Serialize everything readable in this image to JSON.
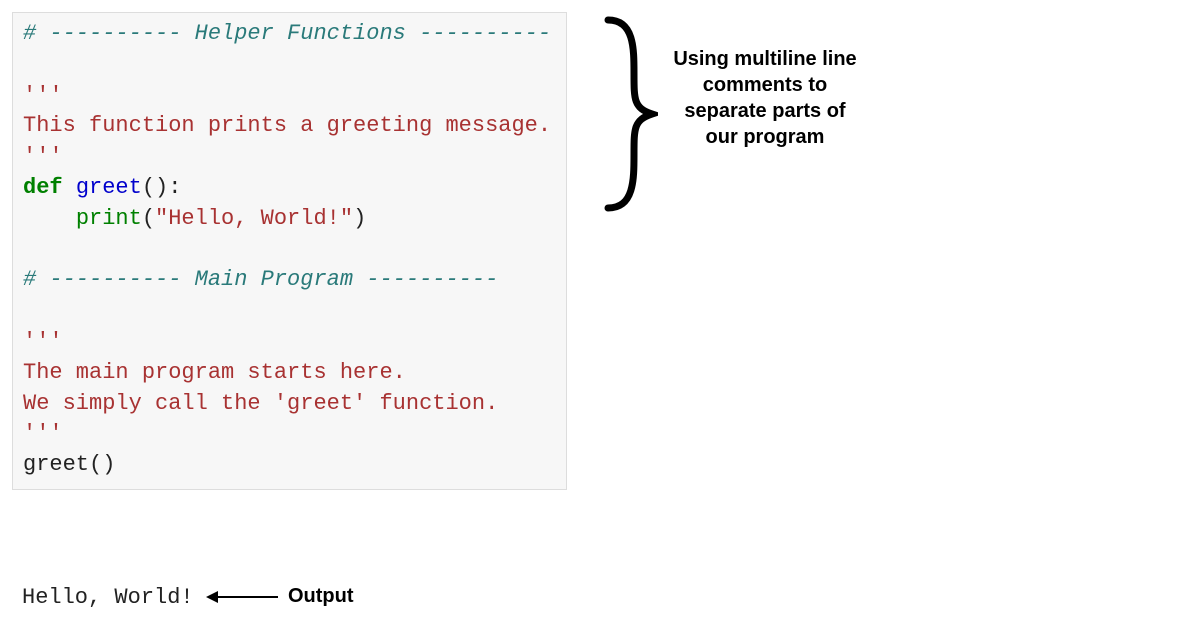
{
  "code": {
    "sec1_comment": "# ---------- Helper Functions ----------",
    "doc1_open": "'''",
    "doc1_body": "This function prints a greeting message.",
    "doc1_close": "'''",
    "def_kw": "def",
    "def_name": "greet",
    "def_parens": "():",
    "print_indent": "    ",
    "print_name": "print",
    "print_open": "(",
    "print_arg": "\"Hello, World!\"",
    "print_close": ")",
    "sec2_comment": "# ---------- Main Program ----------",
    "doc2_open": "'''",
    "doc2_body1": "The main program starts here.",
    "doc2_body2": "We simply call the 'greet' function.",
    "doc2_close": "'''",
    "call": "greet()"
  },
  "output": {
    "text": "Hello, World!",
    "label": "Output"
  },
  "caption": "Using multiline line comments to separate parts of our program",
  "colors": {
    "code_bg": "#f7f7f7",
    "comment": "#2a7a7a",
    "string": "#a83232",
    "keyword": "#008000",
    "function": "#0000cc"
  }
}
